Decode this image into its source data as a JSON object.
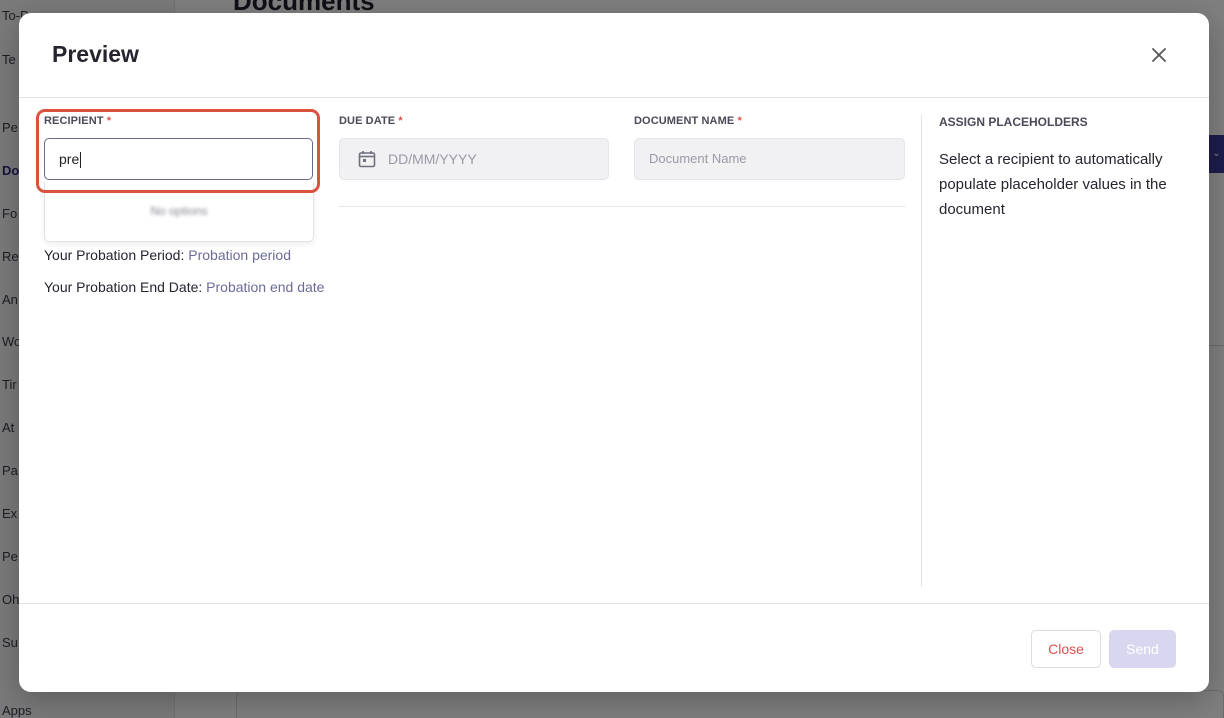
{
  "background": {
    "page_heading": "Documents",
    "sidebar_items": [
      {
        "label": "To-D"
      },
      {
        "label": "Te"
      },
      {
        "label": "Pe"
      },
      {
        "label": "Do"
      },
      {
        "label": "Fo"
      },
      {
        "label": "Re"
      },
      {
        "label": "An"
      },
      {
        "label": "Wo"
      },
      {
        "label": "Tir"
      },
      {
        "label": "At"
      },
      {
        "label": "Pa"
      },
      {
        "label": "Ex"
      },
      {
        "label": "Pe"
      },
      {
        "label": "Oh"
      },
      {
        "label": "Su"
      },
      {
        "label": "Apps"
      }
    ]
  },
  "modal": {
    "title": "Preview",
    "close_icon": "close-icon",
    "fields": {
      "recipient": {
        "label": "RECIPIENT",
        "required_mark": "*",
        "value": "pre",
        "dropdown_message": "No options"
      },
      "due_date": {
        "label": "DUE DATE",
        "required_mark": "*",
        "placeholder": "DD/MM/YYYY",
        "icon": "calendar-icon"
      },
      "document_name": {
        "label": "DOCUMENT NAME",
        "required_mark": "*",
        "placeholder": "Document Name"
      }
    },
    "document_lines": [
      {
        "label": "Your Probation Period:",
        "placeholder": "Probation period"
      },
      {
        "label": "Your Probation End Date:",
        "placeholder": "Probation end date"
      }
    ],
    "assign_placeholders": {
      "heading": "ASSIGN PLACEHOLDERS",
      "text": "Select a recipient to automatically populate placeholder values in the document"
    },
    "buttons": {
      "close": "Close",
      "send": "Send"
    },
    "colors": {
      "highlight": "#d9533f",
      "required": "#d9534f",
      "placeholder_value": "#6b6b9a",
      "send_disabled": "#d9d7ef"
    }
  }
}
